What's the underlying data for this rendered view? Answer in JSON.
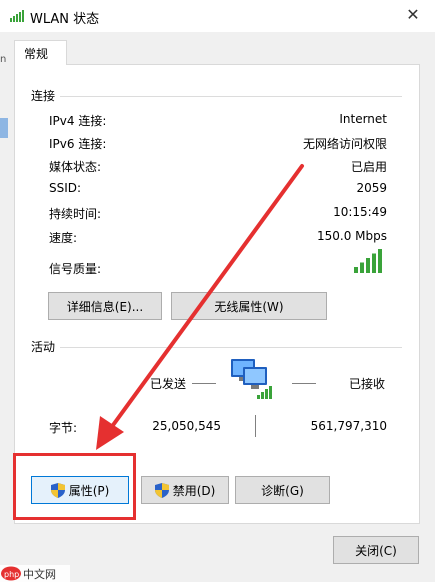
{
  "window": {
    "title": "WLAN 状态",
    "close_glyph": "✕"
  },
  "tabs": [
    {
      "label": "常规"
    }
  ],
  "connection": {
    "heading": "连接",
    "rows": [
      {
        "label": "IPv4 连接:",
        "value": "Internet"
      },
      {
        "label": "IPv6 连接:",
        "value": "无网络访问权限"
      },
      {
        "label": "媒体状态:",
        "value": "已启用"
      },
      {
        "label": "SSID:",
        "value": "2059"
      },
      {
        "label": "持续时间:",
        "value": "10:15:49"
      },
      {
        "label": "速度:",
        "value": "150.0 Mbps"
      }
    ],
    "signal_label": "信号质量:",
    "signal_bars": 5,
    "details_button": "详细信息(E)...",
    "wireless_props_button": "无线属性(W)"
  },
  "activity": {
    "heading": "活动",
    "sent_label": "已发送",
    "received_label": "已接收",
    "bytes_label": "字节:",
    "bytes_sent": "25,050,545",
    "bytes_received": "561,797,310"
  },
  "actions": {
    "properties_button": "属性(P)",
    "disable_button": "禁用(D)",
    "diagnose_button": "诊断(G)"
  },
  "footer": {
    "close_button": "关闭(C)"
  },
  "watermark": {
    "text": "php 中文网"
  },
  "colors": {
    "annotation_red": "#e53030",
    "signal_green": "#3aa33a",
    "focus_blue": "#0078d7"
  }
}
